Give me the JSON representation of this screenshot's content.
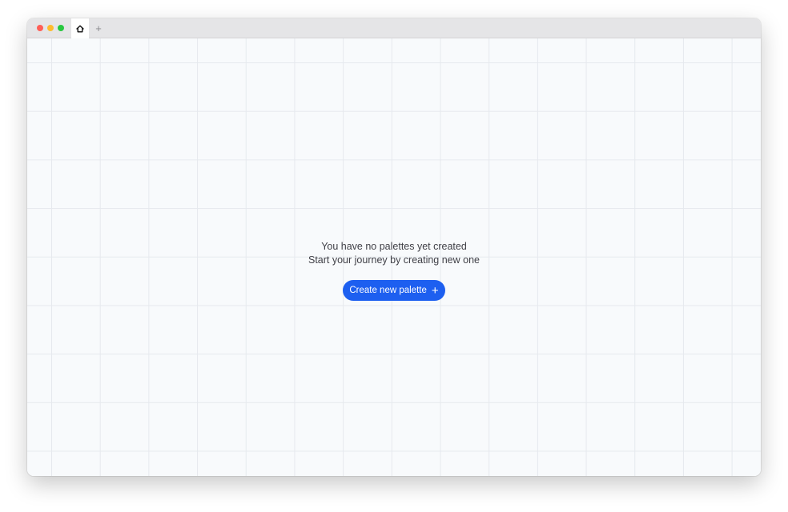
{
  "titlebar": {
    "tabs": [
      {
        "icon": "home-icon"
      }
    ],
    "new_tab_icon": "plus-icon",
    "new_tab_glyph": "+"
  },
  "main": {
    "empty_title": "You have no palettes yet created",
    "empty_subtitle": "Start your journey by creating new one",
    "create_button": {
      "label": "Create new palette",
      "icon": "plus-icon",
      "icon_glyph": "+",
      "color": "#1d5ff0"
    }
  }
}
